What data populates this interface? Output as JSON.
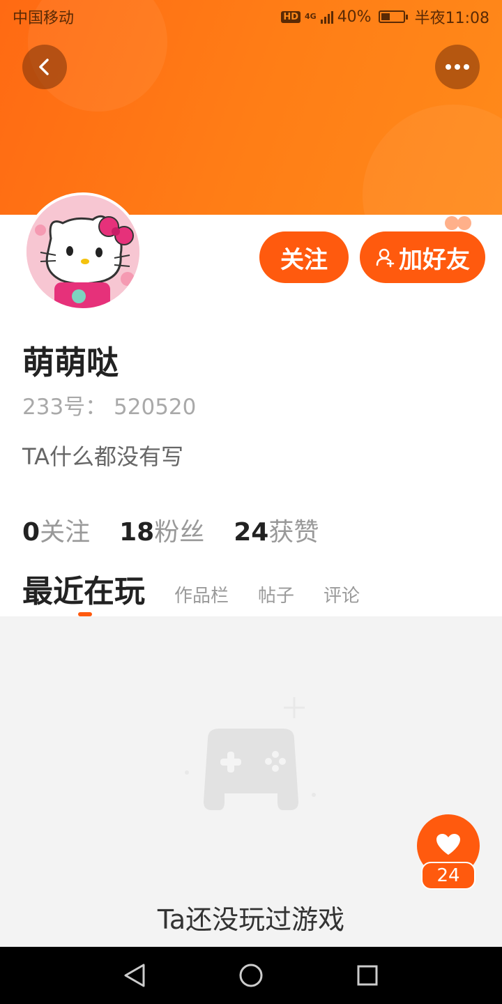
{
  "status_bar": {
    "carrier": "中国移动",
    "hd": "HD",
    "network": "4G",
    "battery": "40%",
    "battery_level": 0.4,
    "time": "半夜11:08"
  },
  "header": {
    "back_icon": "chevron-left-icon",
    "more_icon": "more-dots-icon",
    "accent_color": "#ff5a0e"
  },
  "profile": {
    "avatar_icon": "hello-kitty-avatar",
    "follow_label": "关注",
    "add_friend_label": "加好友",
    "username": "萌萌哒",
    "user_id": "233号： 520520",
    "bio": "TA什么都没有写"
  },
  "stats": [
    {
      "num": "0",
      "label": "关注"
    },
    {
      "num": "18",
      "label": "粉丝"
    },
    {
      "num": "24",
      "label": "获赞"
    }
  ],
  "tabs": [
    {
      "label": "最近在玩",
      "active": true
    },
    {
      "label": "作品栏",
      "active": false
    },
    {
      "label": "帖子",
      "active": false
    },
    {
      "label": "评论",
      "active": false
    }
  ],
  "empty_state": {
    "icon": "gamepad-icon",
    "text": "Ta还没玩过游戏"
  },
  "like_widget": {
    "icon": "heart-icon",
    "count": "24"
  },
  "nav_bar": {
    "back_icon": "triangle-back-icon",
    "home_icon": "circle-home-icon",
    "recent_icon": "square-recent-icon"
  }
}
